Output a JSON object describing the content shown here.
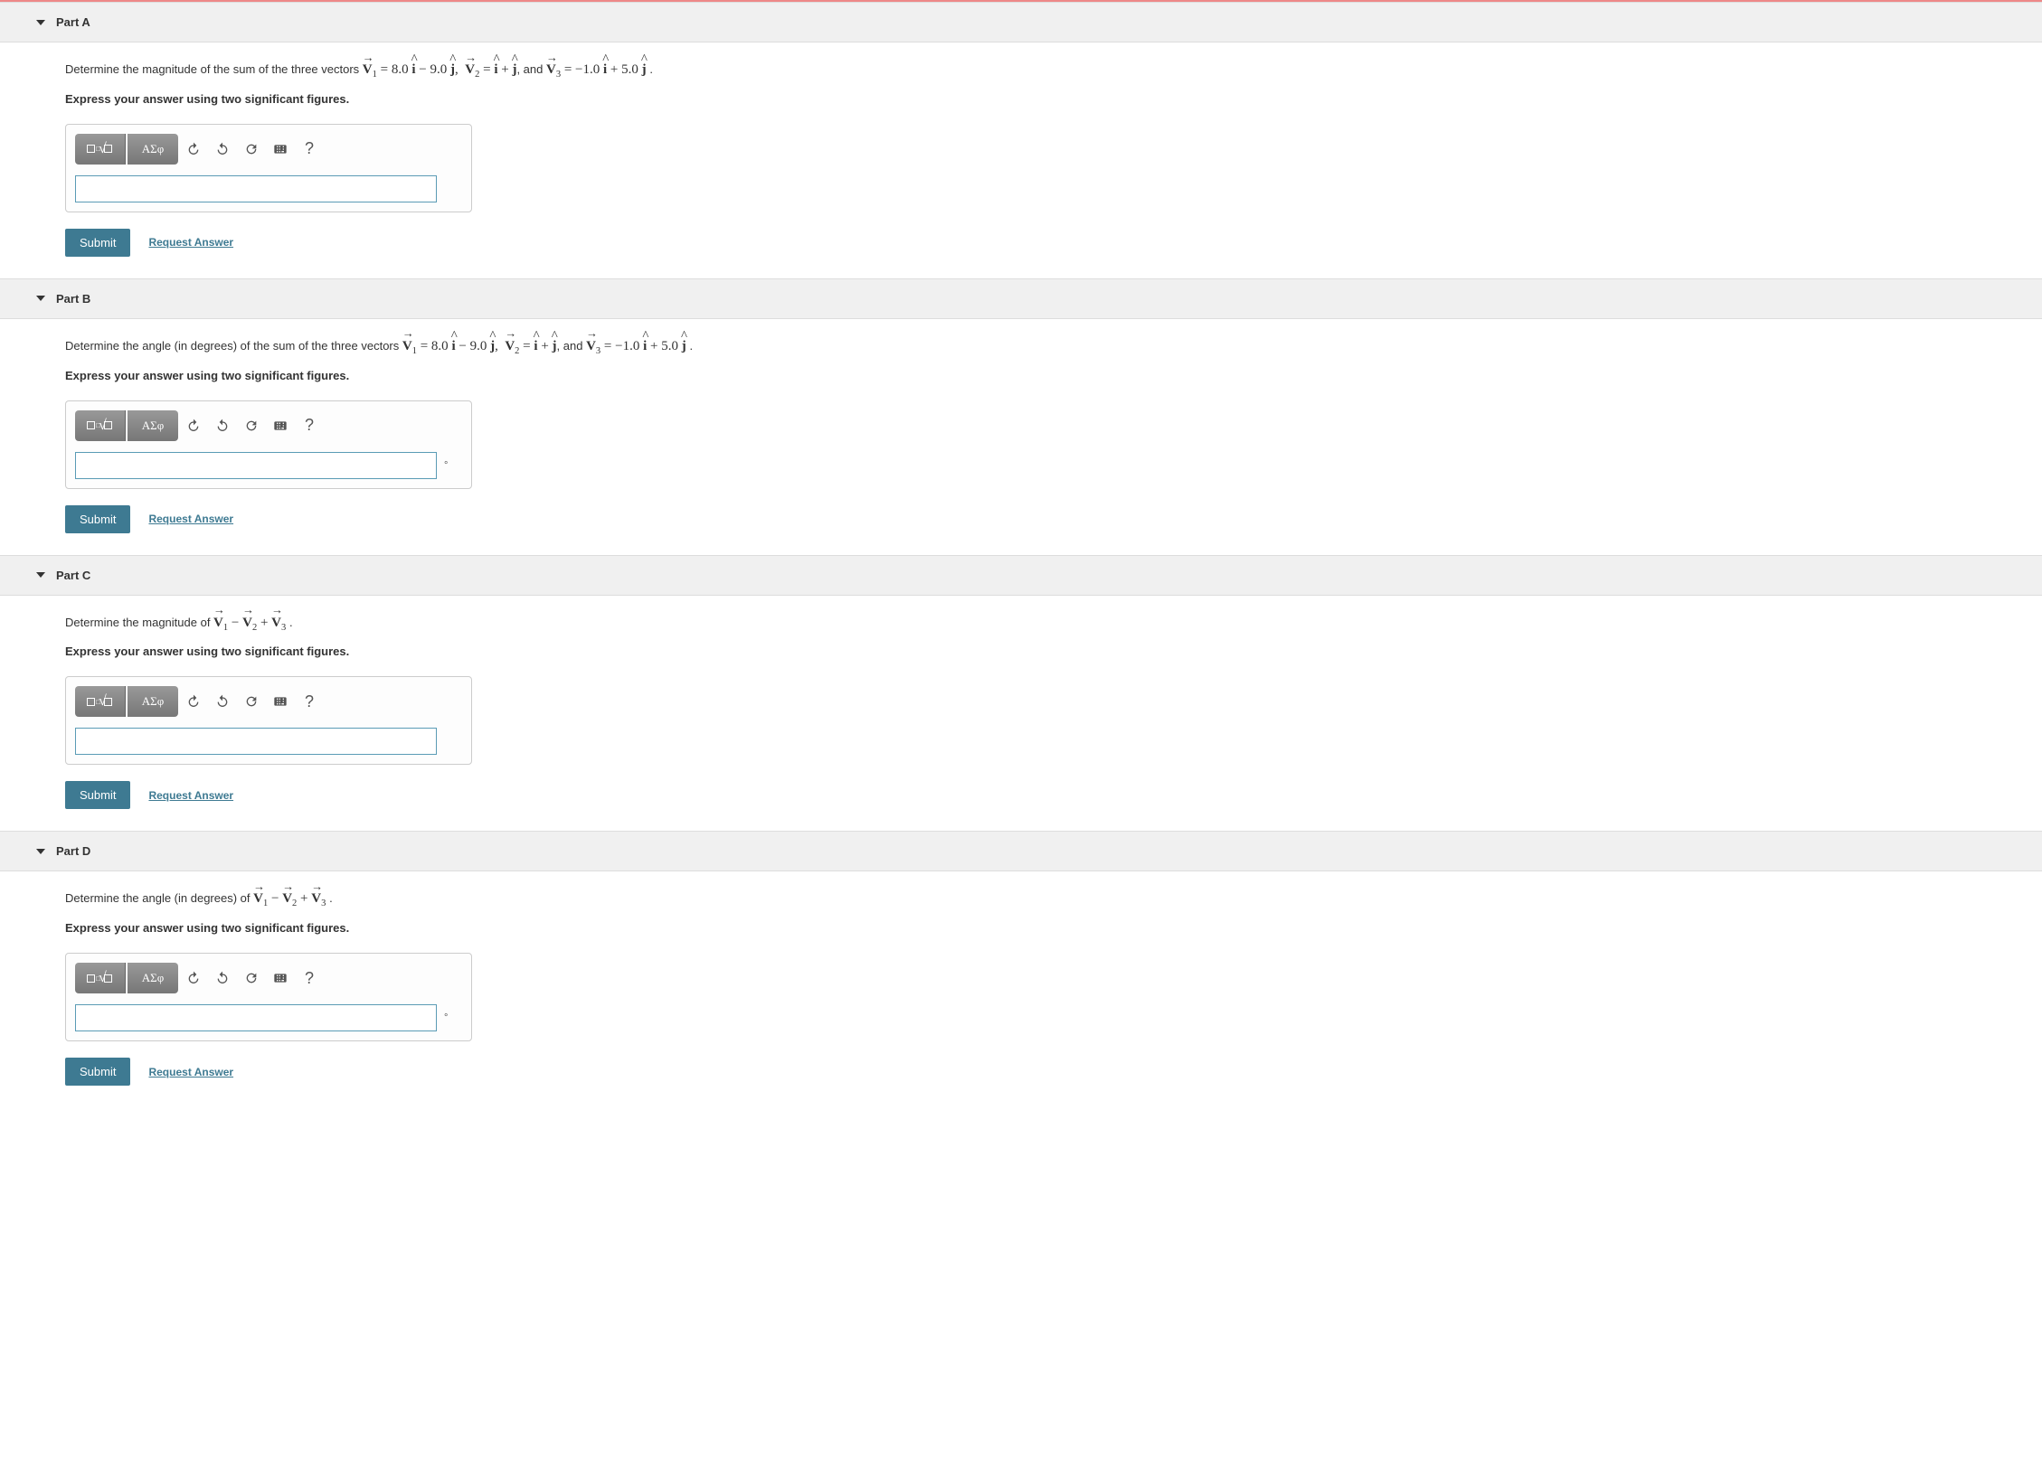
{
  "parts": {
    "a": {
      "label": "Part A",
      "question_prefix": "Determine the magnitude of the sum of the three vectors ",
      "question_suffix": ".",
      "instruction": "Express your answer using two significant figures.",
      "has_unit": false,
      "unit_symbol": ""
    },
    "b": {
      "label": "Part B",
      "question_prefix": "Determine the angle (in degrees) of the sum of the three vectors ",
      "question_suffix": ".",
      "instruction": "Express your answer using two significant figures.",
      "has_unit": true,
      "unit_symbol": "°"
    },
    "c": {
      "label": "Part C",
      "question_prefix": "Determine the magnitude of ",
      "question_suffix": ".",
      "instruction": "Express your answer using two significant figures.",
      "has_unit": false,
      "unit_symbol": ""
    },
    "d": {
      "label": "Part D",
      "question_prefix": "Determine the angle (in degrees) of ",
      "question_suffix": ".",
      "instruction": "Express your answer using two significant figures.",
      "has_unit": true,
      "unit_symbol": "°"
    }
  },
  "vectors": {
    "V1": {
      "i": "8.0",
      "j": "9.0",
      "j_sign": "−"
    },
    "V2": {
      "i": "",
      "j": "",
      "expr": "î + ĵ"
    },
    "V3": {
      "i": "1.0",
      "i_sign": "−",
      "j": "5.0",
      "j_sign": "+"
    },
    "and_text": ", and "
  },
  "toolbar": {
    "template_label": "",
    "greek_label": "ΑΣφ",
    "help_label": "?"
  },
  "buttons": {
    "submit": "Submit",
    "request": "Request Answer"
  }
}
